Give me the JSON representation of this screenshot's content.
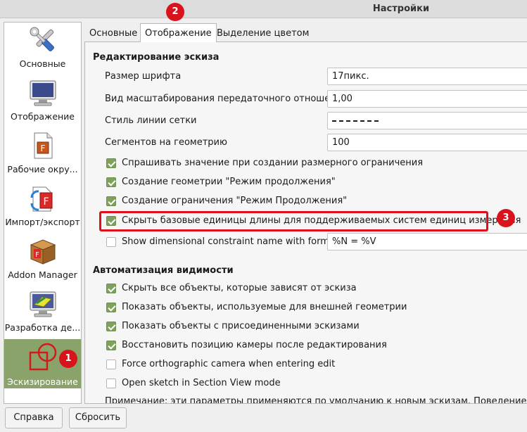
{
  "window": {
    "title": "Настройки"
  },
  "sidebar": {
    "items": [
      {
        "label": "Основные",
        "icon": "wrench-screwdriver-icon"
      },
      {
        "label": "Отображение",
        "icon": "monitor-icon"
      },
      {
        "label": "Рабочие окру...",
        "icon": "workbench-document-icon"
      },
      {
        "label": "Импорт/экспорт",
        "icon": "import-export-icon"
      },
      {
        "label": "Addon Manager",
        "icon": "addon-box-icon"
      },
      {
        "label": "Разработка де...",
        "icon": "part-design-icon"
      },
      {
        "label": "Эскизирование",
        "icon": "sketcher-icon",
        "active": true
      }
    ]
  },
  "tabs": [
    {
      "label": "Основные"
    },
    {
      "label": "Отображение",
      "active": true
    },
    {
      "label": "Выделение цветом"
    }
  ],
  "editing": {
    "title": "Редактирование эскиза",
    "font_size_label": "Размер шрифта",
    "font_size_value": "17пикс.",
    "gear_scale_label": "Вид масштабирования передаточного отношения",
    "gear_scale_value": "1,00",
    "grid_style_label": "Стиль линии сетки",
    "segments_label": "Сегментов на геометрию",
    "segments_value": "100",
    "checkboxes": [
      {
        "label": "Спрашивать значение при создании размерного ограничения",
        "checked": true
      },
      {
        "label": "Создание геометрии \"Режим продолжения\"",
        "checked": true
      },
      {
        "label": "Создание ограничения \"Режим Продолжения\"",
        "checked": true
      },
      {
        "label": "Скрыть базовые единицы длины для поддерживаемых систем единиц измерения",
        "checked": true
      },
      {
        "label": "Show dimensional constraint name with format",
        "checked": false
      }
    ],
    "format_value": "%N = %V"
  },
  "visibility": {
    "title": "Автоматизация видимости",
    "checkboxes": [
      {
        "label": "Скрыть все объекты, которые зависят от эскиза",
        "checked": true
      },
      {
        "label": "Показать объекты, используемые для внешней геометрии",
        "checked": true
      },
      {
        "label": "Показать объекты с присоединенными эскизами",
        "checked": true
      },
      {
        "label": "Восстановить позицию камеры после редактирования",
        "checked": true
      },
      {
        "label": "Force orthographic camera when entering edit",
        "checked": false
      },
      {
        "label": "Open sketch in Section View mode",
        "checked": false
      }
    ],
    "note": "Примечание: эти параметры применяются по умолчанию к новым эскизам. Поведение каждого эскиза"
  },
  "badges": [
    "1",
    "2",
    "3"
  ],
  "buttons": {
    "help": "Справка",
    "reset": "Сбросить"
  },
  "colors": {
    "accent": "#8aa36a",
    "checkbox": "#7ea15b",
    "badge": "#d8131b"
  }
}
